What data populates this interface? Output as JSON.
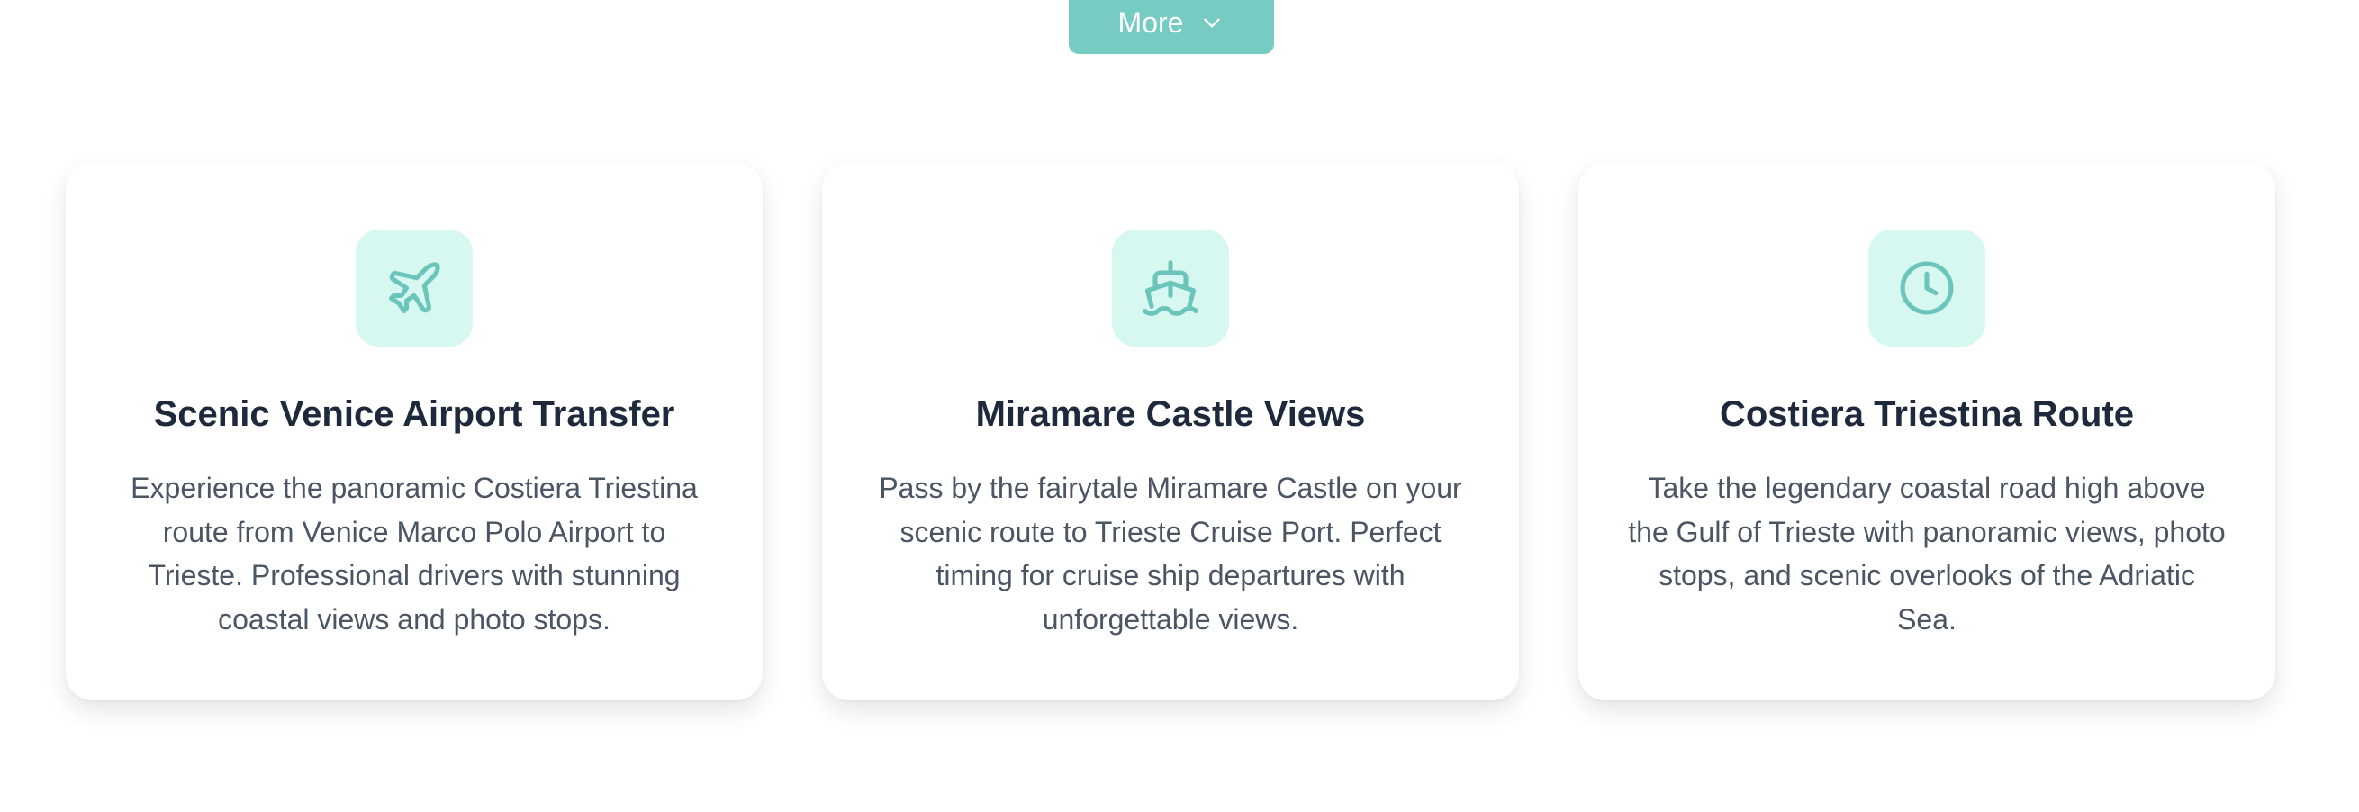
{
  "more_button": {
    "label": "More",
    "icon": "chevron-down-icon"
  },
  "colors": {
    "accent": "#76cbc2",
    "icon_tile_bg": "#d6f8f1",
    "icon_stroke": "#6cc5bb",
    "title": "#1e293b",
    "body_text": "#4b5563"
  },
  "cards": [
    {
      "icon": "airplane-icon",
      "title": "Scenic Venice Airport Transfer",
      "description": "Experience the panoramic Costiera Triestina route from Venice Marco Polo Airport to Trieste. Professional drivers with stunning coastal views and photo stops."
    },
    {
      "icon": "ship-icon",
      "title": "Miramare Castle Views",
      "description": "Pass by the fairytale Miramare Castle on your scenic route to Trieste Cruise Port. Perfect timing for cruise ship departures with unforgettable views."
    },
    {
      "icon": "clock-icon",
      "title": "Costiera Triestina Route",
      "description": "Take the legendary coastal road high above the Gulf of Trieste with panoramic views, photo stops, and scenic overlooks of the Adriatic Sea."
    }
  ]
}
